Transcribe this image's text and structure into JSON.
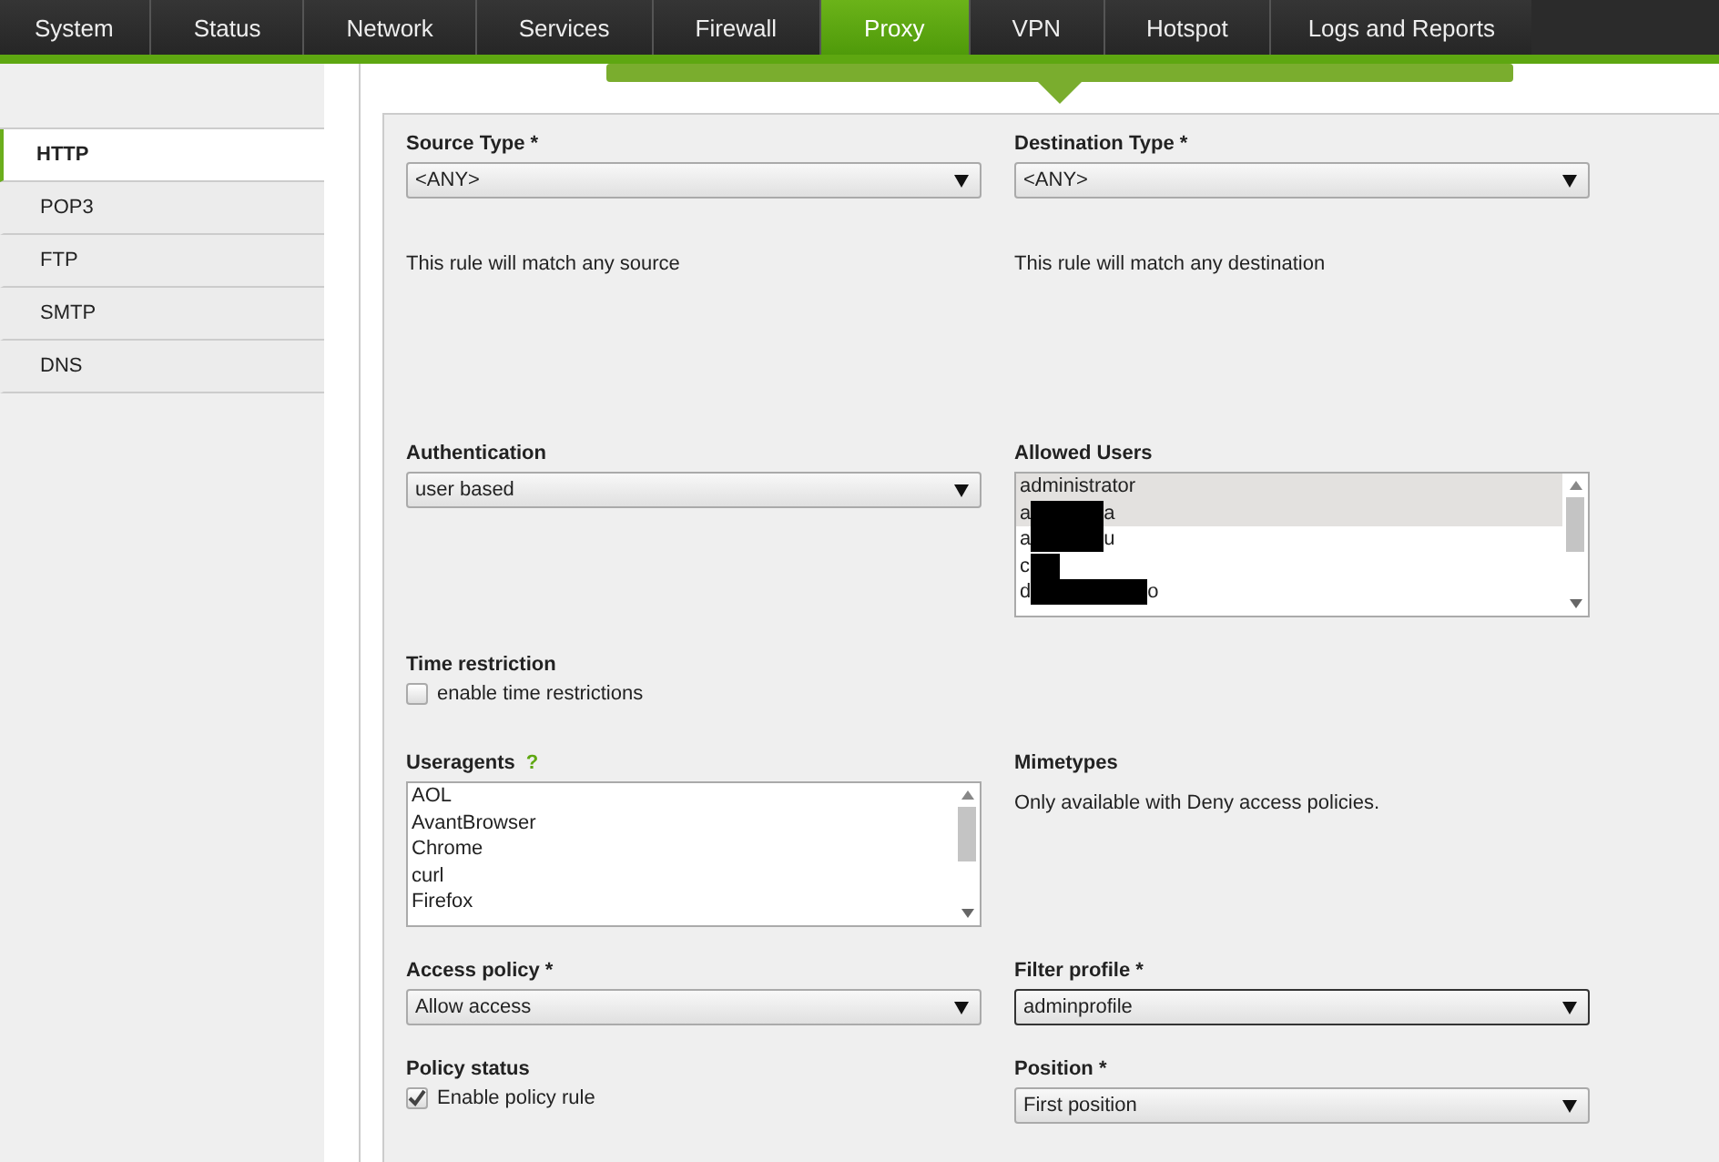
{
  "nav": [
    {
      "label": "System",
      "selected": false
    },
    {
      "label": "Status",
      "selected": false
    },
    {
      "label": "Network",
      "selected": false
    },
    {
      "label": "Services",
      "selected": false
    },
    {
      "label": "Firewall",
      "selected": false
    },
    {
      "label": "Proxy",
      "selected": true
    },
    {
      "label": "VPN",
      "selected": false
    },
    {
      "label": "Hotspot",
      "selected": false
    },
    {
      "label": "Logs and Reports",
      "selected": false
    }
  ],
  "sidebar": {
    "items": [
      {
        "label": "HTTP",
        "selected": true
      },
      {
        "label": "POP3",
        "selected": false
      },
      {
        "label": "FTP",
        "selected": false
      },
      {
        "label": "SMTP",
        "selected": false
      },
      {
        "label": "DNS",
        "selected": false
      }
    ]
  },
  "form": {
    "source_type": {
      "label": "Source Type *",
      "value": "<ANY>",
      "note": "This rule will match any source"
    },
    "destination_type": {
      "label": "Destination Type *",
      "value": "<ANY>",
      "note": "This rule will match any destination"
    },
    "authentication": {
      "label": "Authentication",
      "value": "user based"
    },
    "allowed_users": {
      "label": "Allowed Users",
      "items": [
        {
          "text": "administrator",
          "redacted": false,
          "selected": true
        },
        {
          "text": "a",
          "suffix": "a",
          "redacted": true,
          "selected": true
        },
        {
          "text": "a",
          "suffix": "u",
          "redacted": true,
          "selected": false
        },
        {
          "text": "c",
          "redacted": true,
          "selected": false
        },
        {
          "text": "d",
          "suffix": "o",
          "redacted": true,
          "selected": false
        }
      ]
    },
    "time_restriction": {
      "label": "Time restriction",
      "checkbox": "enable time restrictions",
      "checked": false
    },
    "useragents": {
      "label": "Useragents",
      "help": "?",
      "items": [
        "AOL",
        "AvantBrowser",
        "Chrome",
        "curl",
        "Firefox"
      ]
    },
    "mimetypes": {
      "label": "Mimetypes",
      "note": "Only available with Deny access policies."
    },
    "access_policy": {
      "label": "Access policy *",
      "value": "Allow access"
    },
    "filter_profile": {
      "label": "Filter profile *",
      "value": "adminprofile",
      "focused": true
    },
    "policy_status": {
      "label": "Policy status",
      "checkbox": "Enable policy rule",
      "checked": true
    },
    "position": {
      "label": "Position *",
      "value": "First position"
    }
  }
}
